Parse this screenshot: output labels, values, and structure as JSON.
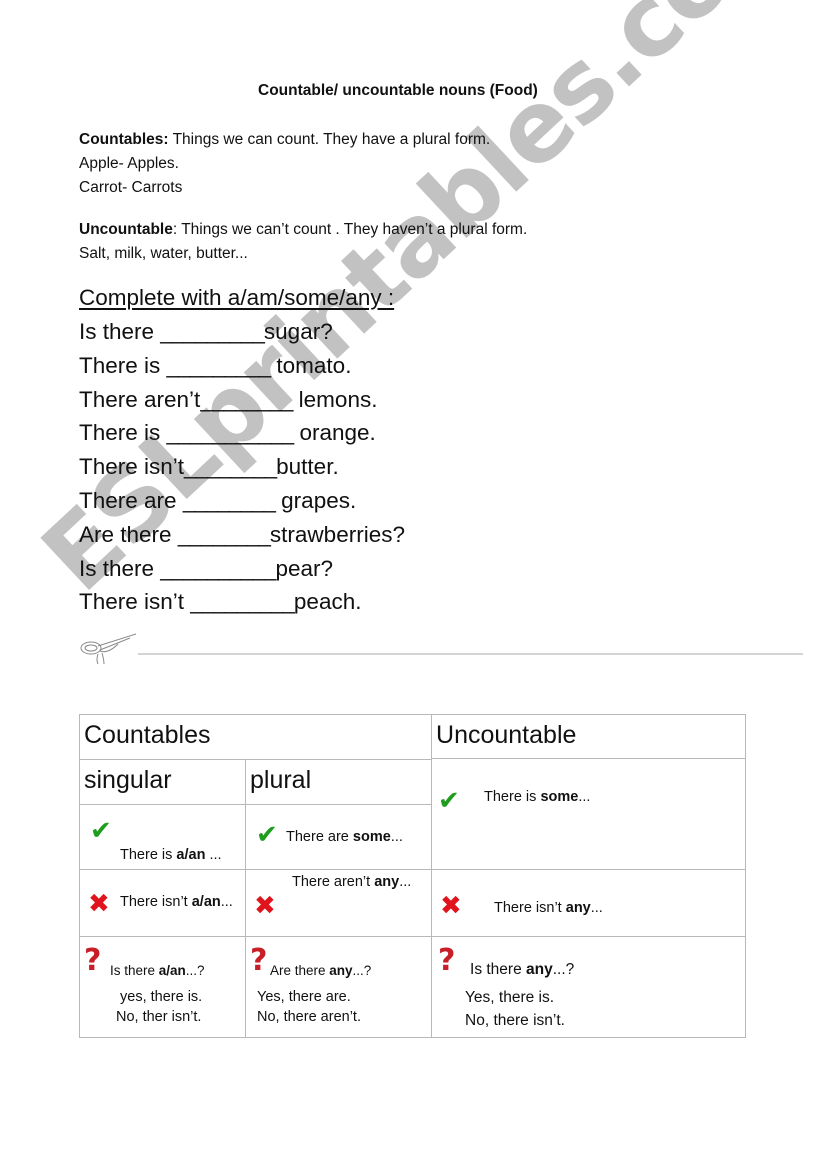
{
  "document": {
    "title": "Countable/ uncountable nouns (Food)",
    "intro": {
      "countables_label": "Countables:",
      "countables_text": " Things we can count. They have a plural form.",
      "countables_examples": [
        "Apple- Apples.",
        "Carrot- Carrots"
      ],
      "uncountable_label": "Uncountable",
      "uncountable_text": ": Things we can’t count . They haven’t a plural form.",
      "uncountable_examples": "Salt, milk, water, butter..."
    },
    "exercise": {
      "heading": "Complete with a/am/some/any  :",
      "items": [
        {
          "before": "Is there ",
          "blank": "_________",
          "after": "sugar?"
        },
        {
          "before": "There is ",
          "blank": "_________",
          "after": " tomato."
        },
        {
          "before": "There aren’t",
          "blank": "________",
          "after": " lemons."
        },
        {
          "before": "There is ",
          "blank": "___________",
          "after": " orange."
        },
        {
          "before": "There isn’t",
          "blank": "________",
          "after": "butter."
        },
        {
          "before": "There are ",
          "blank": "________",
          "after": " grapes."
        },
        {
          "before": "Are there ",
          "blank": "________",
          "after": "strawberries?"
        },
        {
          "before": "Is there ",
          "blank": "__________",
          "after": "pear?"
        },
        {
          "before": "There isn’t ",
          "blank": "_________",
          "after": "peach."
        }
      ]
    },
    "cut_line": {
      "icon": "scissors-icon"
    },
    "table": {
      "countables_header": "Countables",
      "uncountable_header": "Uncountable",
      "singular_header": "singular",
      "plural_header": "plural",
      "icons": {
        "affirmative": "✔",
        "negative": "✖",
        "question": "?"
      },
      "colors": {
        "check": "#1f9d1f",
        "cross": "#e0141c",
        "question": "#c81e28",
        "border": "#b8b8b8"
      },
      "singular": {
        "affirmative": {
          "pre": "There is ",
          "bold": "a/an",
          "post": " ..."
        },
        "negative": {
          "pre": "There isn’t ",
          "bold": "a/an",
          "post": "..."
        },
        "question": {
          "pre": "Is there ",
          "bold": "a/an",
          "post": "...?",
          "yes": "yes, there is.",
          "no": "No, ther isn’t."
        }
      },
      "plural": {
        "affirmative": {
          "pre": "There are ",
          "bold": "some",
          "post": "..."
        },
        "negative": {
          "pre": "There aren’t ",
          "bold": "any",
          "post": "..."
        },
        "question": {
          "pre": "Are there ",
          "bold": "any",
          "post": "...?",
          "yes": "Yes, there are.",
          "no": "No, there aren’t."
        }
      },
      "uncountable": {
        "affirmative": {
          "pre": "There is ",
          "bold": "some",
          "post": "..."
        },
        "negative": {
          "pre": "There isn’t ",
          "bold": "any",
          "post": "..."
        },
        "question": {
          "pre": "Is there ",
          "bold": "any",
          "post": "...?",
          "yes": "Yes, there is.",
          "no": "No, there isn’t."
        }
      }
    },
    "watermark": "ESLprintables.com"
  }
}
